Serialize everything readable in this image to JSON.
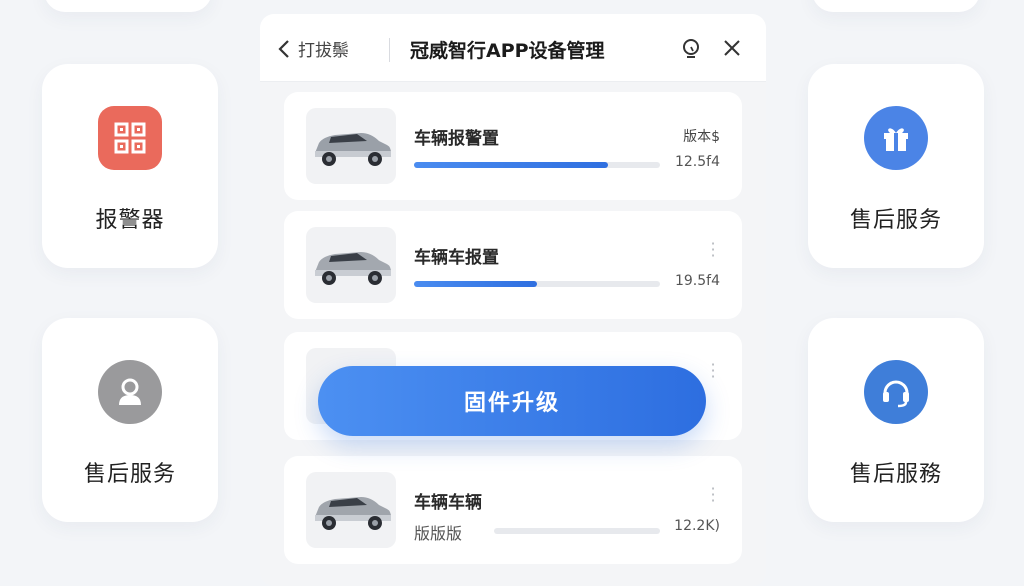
{
  "tiles": {
    "left_top": {
      "label": "报警器",
      "icon": "qr-code-icon",
      "color": "#ea6a5c"
    },
    "left_bottom": {
      "label": "售后服务",
      "icon": "lock-person-icon",
      "color": "#9a9a9c"
    },
    "right_top": {
      "label": "售后服务",
      "icon": "gift-icon",
      "color": "#4b84e6"
    },
    "right_bottom": {
      "label": "售后服務",
      "icon": "headset-icon",
      "color": "#3f7ed9"
    }
  },
  "panel": {
    "back_label": "打拔鬃",
    "title": "冠威智行APP设备管理",
    "items": [
      {
        "title": "车辆报警置",
        "badge": "版本$",
        "value": "12.5f4",
        "progress": 0.79
      },
      {
        "title": "车辆车报置",
        "value": "19.5f4",
        "progress": 0.5
      },
      {
        "title": "",
        "value": "",
        "progress": 0.0
      },
      {
        "title": "车辆车辆",
        "sub": "版版版",
        "value": "12.2K)",
        "progress": 0.0
      }
    ]
  },
  "actions": {
    "upgrade_label": "固件升级"
  }
}
